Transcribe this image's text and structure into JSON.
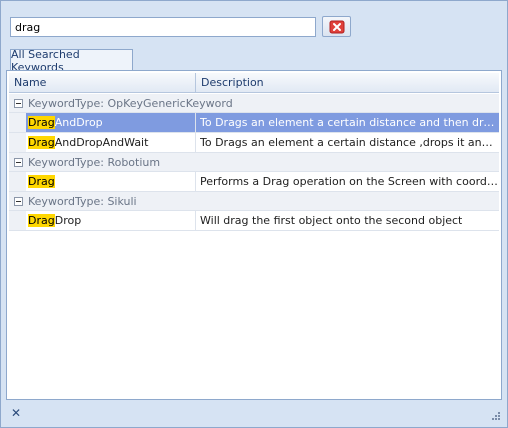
{
  "search": {
    "value": "drag"
  },
  "tab": {
    "label": "All Searched Keywords"
  },
  "columns": {
    "name": "Name",
    "description": "Description"
  },
  "groups": [
    {
      "label": "KeywordType: OpKeyGenericKeyword",
      "rows": [
        {
          "match": "Drag",
          "rest": "AndDrop",
          "description": "To Drags an element a certain distance and then drops it",
          "selected": true
        },
        {
          "match": "Drag",
          "rest": "AndDropAndWait",
          "description": "To Drags an element a certain distance ,drops it and wait",
          "selected": false
        }
      ]
    },
    {
      "label": "KeywordType: Robotium",
      "rows": [
        {
          "match": "Drag",
          "rest": "",
          "description": "Performs a Drag operation on the Screen with coordinates specified",
          "selected": false
        }
      ]
    },
    {
      "label": "KeywordType: Sikuli",
      "rows": [
        {
          "match": "Drag",
          "rest": "Drop",
          "description": "Will drag the first object onto the second object",
          "selected": false
        }
      ]
    }
  ],
  "icons": {
    "clear": "red-x-icon",
    "close": "close-icon",
    "grip": "resize-grip-icon",
    "toggle": "collapse-icon"
  },
  "colors": {
    "selection": "#7f9be0",
    "highlight": "#ffd700",
    "frame": "#d6e3f3"
  }
}
